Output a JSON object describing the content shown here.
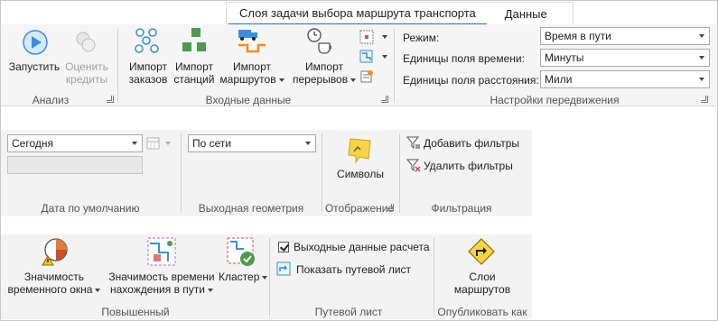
{
  "tabs": [
    {
      "label": "Слоя задачи выбора маршрута транспорта",
      "active": true
    },
    {
      "label": "Данные",
      "active": false
    }
  ],
  "analysis": {
    "run_label": "Запустить",
    "estimate_label_1": "Оценить",
    "estimate_label_2": "кредиты",
    "group_label": "Анализ"
  },
  "input_data": {
    "import_orders_1": "Импорт",
    "import_orders_2": "заказов",
    "import_stations_1": "Импорт",
    "import_stations_2": "станций",
    "import_routes_1": "Импорт",
    "import_routes_2": "маршрутов",
    "import_breaks_1": "Импорт",
    "import_breaks_2": "перерывов",
    "group_label": "Входные данные"
  },
  "travel_settings": {
    "mode_label": "Режим:",
    "mode_value": "Время в пути",
    "time_units_label": "Единицы поля времени:",
    "time_units_value": "Минуты",
    "distance_units_label": "Единицы поля расстояния:",
    "distance_units_value": "Мили",
    "group_label": "Настройки передвижения"
  },
  "default_date": {
    "date_value": "Сегодня",
    "group_label": "Дата по умолчанию"
  },
  "output_geometry": {
    "value": "По сети",
    "group_label": "Выходная геометрия"
  },
  "display": {
    "symbols_label": "Символы",
    "group_label": "Отображение"
  },
  "filtering": {
    "add_filters_label": "Добавить фильтры",
    "remove_filters_label": "Удалить фильтры",
    "group_label": "Фильтрация"
  },
  "advanced": {
    "time_window_1": "Значимость",
    "time_window_2": "временного окна",
    "travel_time_1": "Значимость времени",
    "travel_time_2": "нахождения в пути",
    "cluster_label": "Кластер",
    "group_label": "Повышенный"
  },
  "directions": {
    "output_calc_label": "Выходные данные расчета",
    "show_directions_label": "Показать путевой лист",
    "group_label": "Путевой лист"
  },
  "publish": {
    "route_layers_1": "Слои",
    "route_layers_2": "маршрутов",
    "group_label": "Опубликовать как"
  },
  "colors": {
    "accent": "#1e73c8",
    "run_icon": "#3a8fd9",
    "green_icon": "#4f9a4f",
    "orange_icon": "#f28c1e",
    "yellow_symbol": "#f5d547"
  }
}
